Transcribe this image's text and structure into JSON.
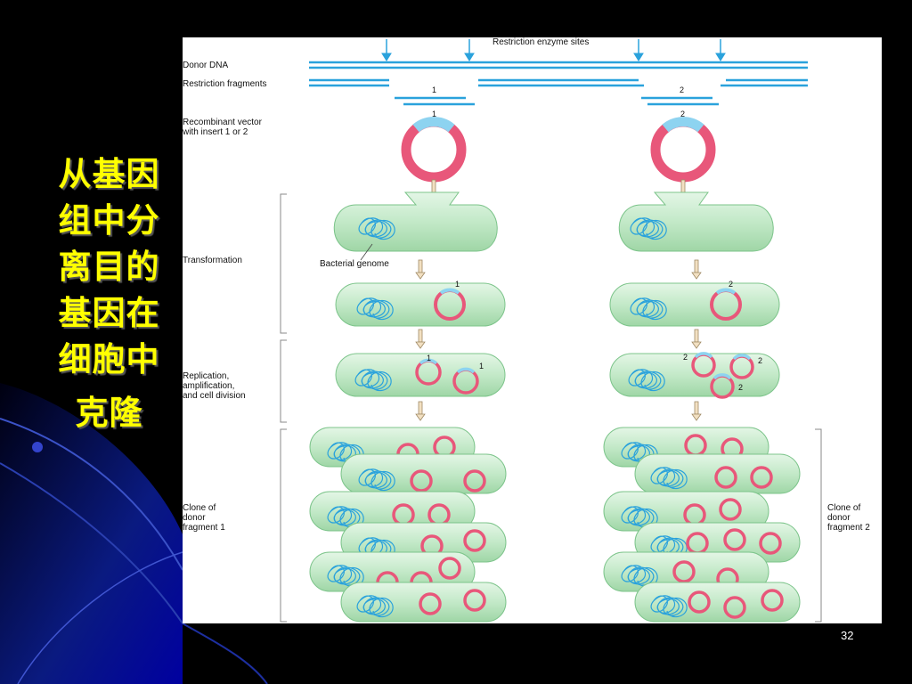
{
  "slide": {
    "title_lines": [
      "从基因",
      "组中分",
      "离目的",
      "基因在",
      "细胞中",
      "克隆"
    ],
    "page_number": "32"
  },
  "figure": {
    "restriction_sites_label": "Restriction enzyme sites",
    "donor_dna_label": "Donor DNA",
    "restriction_fragments_label": "Restriction fragments",
    "recombinant_vector_label_line1": "Recombinant vector",
    "recombinant_vector_label_line2": "with insert 1 or 2",
    "transformation_label": "Transformation",
    "bacterial_genome_label": "Bacterial genome",
    "replication_label_line1": "Replication,",
    "replication_label_line2": "amplification,",
    "replication_label_line3": "and cell division",
    "clone1_label_line1": "Clone of",
    "clone1_label_line2": "donor",
    "clone1_label_line3": "fragment 1",
    "clone2_label_line1": "Clone of",
    "clone2_label_line2": "donor",
    "clone2_label_line3": "fragment 2",
    "fragment_1": "1",
    "fragment_2": "2"
  },
  "colors": {
    "dna_blue": "#2aa2dc",
    "plasmid_pink": "#e8577a",
    "cell_green": "#bfe6c4",
    "title_yellow": "#ffff00"
  }
}
